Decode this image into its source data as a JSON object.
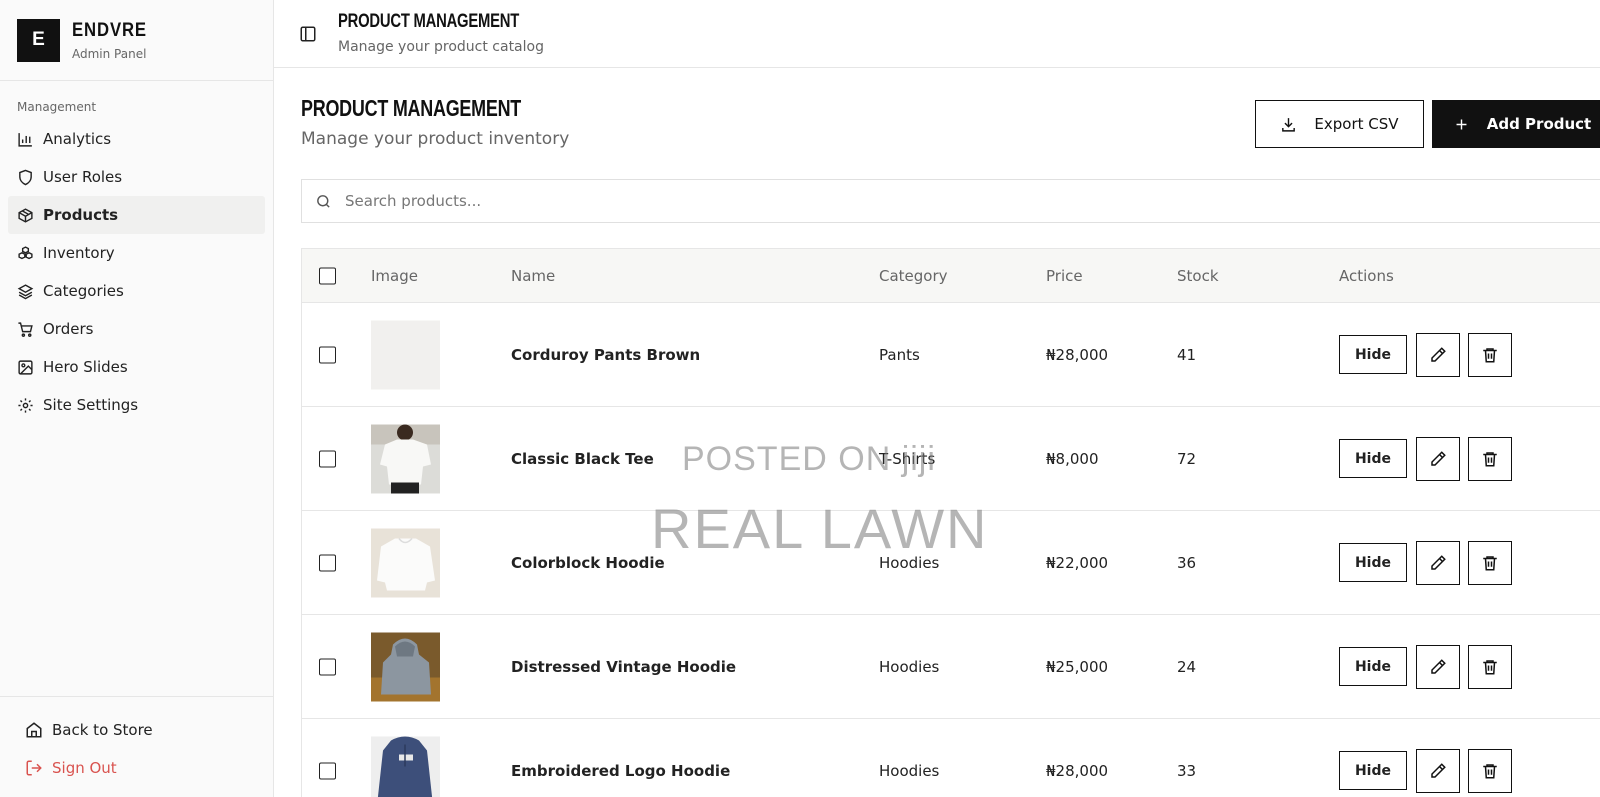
{
  "brand": {
    "logo_letter": "E",
    "name": "ENDVRE",
    "subtitle": "Admin Panel"
  },
  "sidebar": {
    "section_label": "Management",
    "items": [
      {
        "label": "Analytics",
        "icon": "bar-chart-icon"
      },
      {
        "label": "User Roles",
        "icon": "shield-icon"
      },
      {
        "label": "Products",
        "icon": "package-icon",
        "active": true
      },
      {
        "label": "Inventory",
        "icon": "boxes-icon"
      },
      {
        "label": "Categories",
        "icon": "layers-icon"
      },
      {
        "label": "Orders",
        "icon": "cart-icon"
      },
      {
        "label": "Hero Slides",
        "icon": "image-icon"
      },
      {
        "label": "Site Settings",
        "icon": "gear-icon"
      }
    ],
    "back_to_store": "Back to Store",
    "sign_out": "Sign Out"
  },
  "topbar": {
    "title": "PRODUCT MANAGEMENT",
    "subtitle": "Manage your product catalog"
  },
  "page": {
    "title": "PRODUCT MANAGEMENT",
    "subtitle": "Manage your product inventory",
    "export_label": "Export CSV",
    "add_label": "Add Product"
  },
  "search": {
    "placeholder": "Search products...",
    "value": ""
  },
  "table": {
    "headers": [
      "Image",
      "Name",
      "Category",
      "Price",
      "Stock",
      "Actions"
    ],
    "rows": [
      {
        "name": "Corduroy Pants Brown",
        "category": "Pants",
        "price": "₦28,000",
        "stock": "41",
        "image": "blank"
      },
      {
        "name": "Classic Black Tee",
        "category": "T-Shirts",
        "price": "₦8,000",
        "stock": "72",
        "image": "white-tee"
      },
      {
        "name": "Colorblock Hoodie",
        "category": "Hoodies",
        "price": "₦22,000",
        "stock": "36",
        "image": "white-hoodie"
      },
      {
        "name": "Distressed Vintage Hoodie",
        "category": "Hoodies",
        "price": "₦25,000",
        "stock": "24",
        "image": "grey-hoodie"
      },
      {
        "name": "Embroidered Logo Hoodie",
        "category": "Hoodies",
        "price": "₦28,000",
        "stock": "33",
        "image": "navy-hoodie"
      }
    ],
    "hide_label": "Hide"
  },
  "watermark": {
    "line1": "POSTED ON jiji",
    "line2": "REAL LAWN"
  },
  "colors": {
    "accent": "#111111",
    "danger": "#d9534f",
    "sidebar_bg": "#fafafa",
    "header_bg": "#f7f7f5"
  }
}
